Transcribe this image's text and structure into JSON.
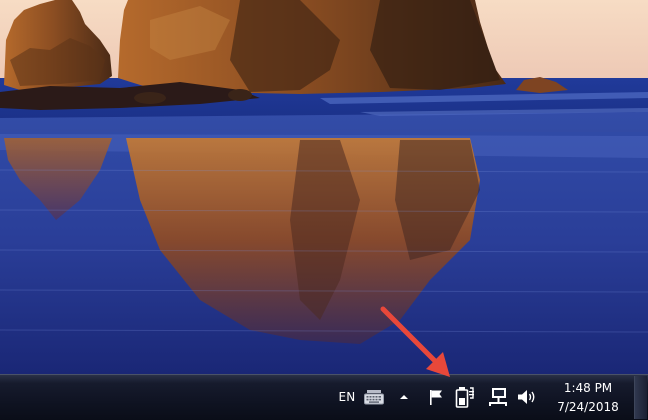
{
  "taskbar": {
    "language": "EN",
    "clock": {
      "time": "1:48 PM",
      "date": "7/24/2018"
    }
  },
  "icons": {
    "keyboard": "keyboard-icon",
    "show_hidden": "chevron-up-icon",
    "action_center": "flag-icon",
    "battery": "battery-icon",
    "network": "network-icon",
    "volume": "speaker-icon"
  },
  "colors": {
    "arrow": "#e8483a",
    "taskbar": "#0f1322",
    "text": "#ffffff"
  }
}
